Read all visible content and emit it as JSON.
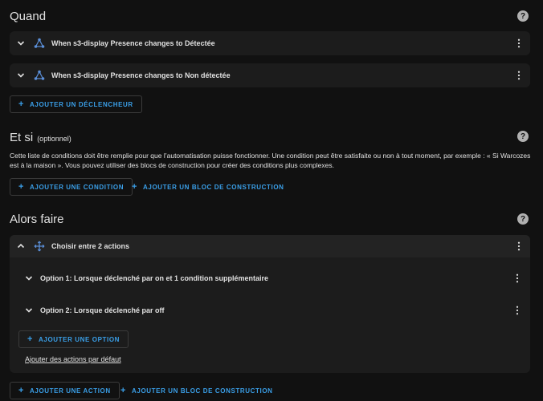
{
  "quand": {
    "title": "Quand",
    "triggers": [
      {
        "label": "When s3-display Presence changes to Détectée"
      },
      {
        "label": "When s3-display Presence changes to Non détectée"
      }
    ],
    "add_trigger_label": "AJOUTER UN DÉCLENCHEUR"
  },
  "etsi": {
    "title": "Et si",
    "subtitle": "(optionnel)",
    "description": "Cette liste de conditions doit être remplie pour que l’automatisation puisse fonctionner. Une condition peut être satisfaite ou non à tout moment, par exemple : « Si Warcozes est à la maison ». Vous pouvez utiliser des blocs de construction pour créer des conditions plus complexes.",
    "add_condition_label": "AJOUTER UNE CONDITION",
    "add_block_label": "AJOUTER UN BLOC DE CONSTRUCTION"
  },
  "alors": {
    "title": "Alors faire",
    "choose": {
      "label": "Choisir entre 2 actions",
      "options": [
        {
          "label": "Option 1: Lorsque déclenché par on et 1 condition supplémentaire"
        },
        {
          "label": "Option 2: Lorsque déclenché par off"
        }
      ],
      "add_option_label": "AJOUTER UNE OPTION",
      "default_actions_link": "Ajouter des actions par défaut"
    },
    "add_action_label": "AJOUTER UNE ACTION",
    "add_block_label": "AJOUTER UN BLOC DE CONSTRUCTION"
  },
  "icons": {
    "help": "?",
    "plus": "+"
  },
  "colors": {
    "background": "#111111",
    "card": "#1c1c1c",
    "accent": "#3a9fe8",
    "icon_blue": "#5b8fd8"
  }
}
